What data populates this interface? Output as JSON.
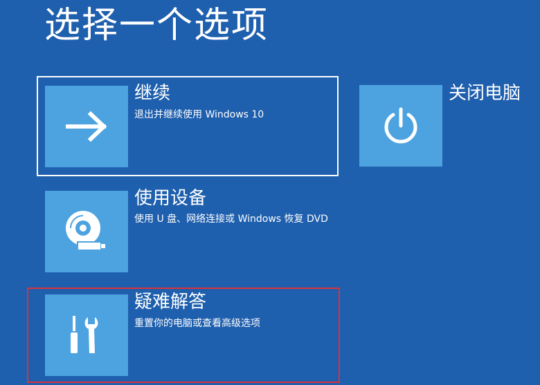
{
  "page": {
    "title": "选择一个选项"
  },
  "options": {
    "continue": {
      "title": "继续",
      "description": "退出并继续使用 Windows 10",
      "icon": "arrow-right-icon"
    },
    "use_device": {
      "title": "使用设备",
      "description": "使用 U 盘、网络连接或 Windows 恢复 DVD",
      "icon": "disc-drive-icon"
    },
    "troubleshoot": {
      "title": "疑难解答",
      "description": "重置你的电脑或查看高级选项",
      "icon": "tools-icon"
    },
    "shutdown": {
      "title": "关闭电脑",
      "icon": "power-icon"
    }
  },
  "colors": {
    "background": "#1e5fae",
    "tile": "#4da3df",
    "selected_border": "#ffffff",
    "highlight_border": "#e0303a"
  }
}
